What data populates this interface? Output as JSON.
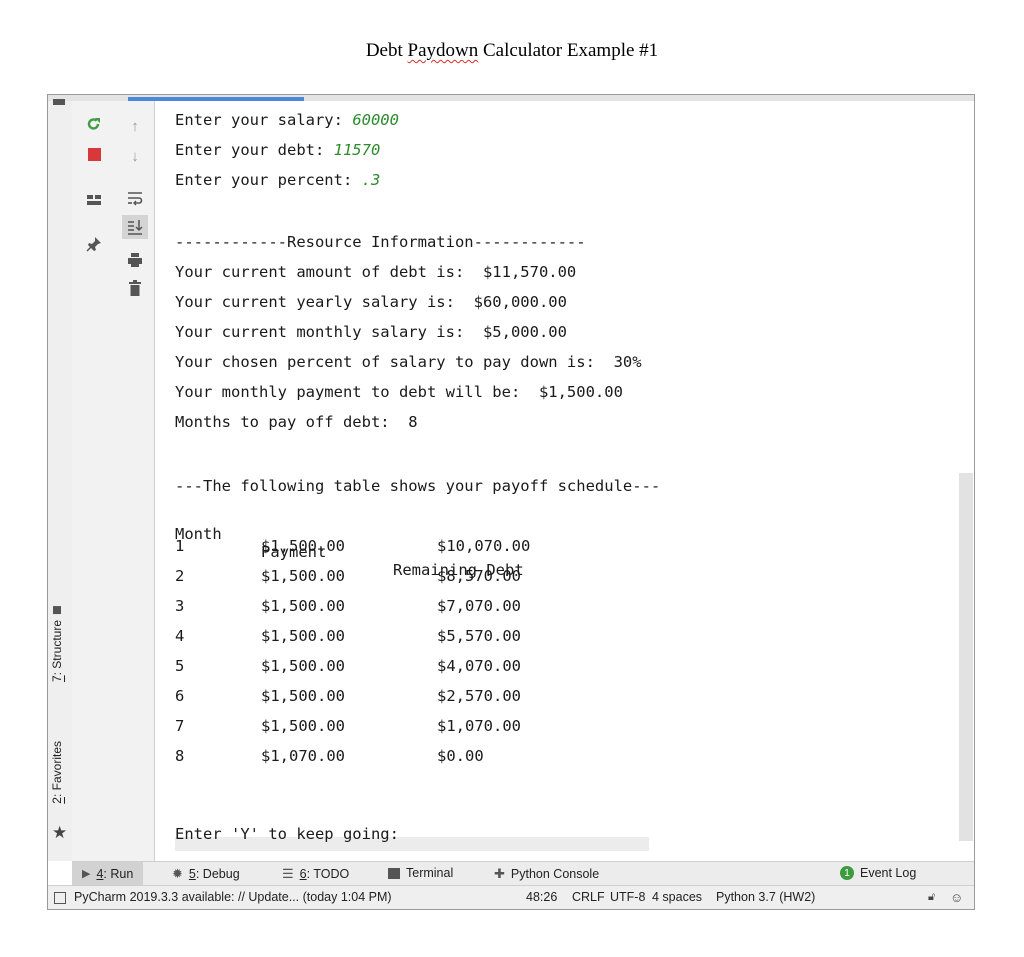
{
  "document": {
    "title_pre": "Debt ",
    "title_spell": "Paydown",
    "title_post": " Calculator Example #1"
  },
  "sidebar": {
    "structure_num": "7",
    "structure_label": ": Structure",
    "favorites_num": "2",
    "favorites_label": ": Favorites"
  },
  "console": {
    "prompts": [
      {
        "label": "Enter your salary: ",
        "value": "60000"
      },
      {
        "label": "Enter your debt: ",
        "value": "11570"
      },
      {
        "label": "Enter your percent: ",
        "value": ".3"
      }
    ],
    "lines": [
      "------------Resource Information------------",
      "Your current amount of debt is:  $11,570.00",
      "Your current yearly salary is:  $60,000.00",
      "Your current monthly salary is:  $5,000.00",
      "Your chosen percent of salary to pay down is:  30%",
      "Your monthly payment to debt will be:  $1,500.00",
      "Months to pay off debt:  8",
      "",
      "---The following table shows your payoff schedule---"
    ],
    "table": {
      "headers": [
        "Month",
        "Payment",
        "Remaining Debt"
      ],
      "rows": [
        [
          "1",
          "$1,500.00",
          "$10,070.00"
        ],
        [
          "2",
          "$1,500.00",
          "$8,570.00"
        ],
        [
          "3",
          "$1,500.00",
          "$7,070.00"
        ],
        [
          "4",
          "$1,500.00",
          "$5,570.00"
        ],
        [
          "5",
          "$1,500.00",
          "$4,070.00"
        ],
        [
          "6",
          "$1,500.00",
          "$2,570.00"
        ],
        [
          "7",
          "$1,500.00",
          "$1,070.00"
        ],
        [
          "8",
          "$1,070.00",
          "$0.00"
        ]
      ]
    },
    "final_prompt": "Enter 'Y' to keep going: "
  },
  "toolwindows": [
    {
      "num": "4",
      "label": ": Run",
      "icon": "run-icon"
    },
    {
      "num": "5",
      "label": ": Debug",
      "icon": "bug-icon"
    },
    {
      "num": "6",
      "label": ": TODO",
      "icon": "list-icon"
    },
    {
      "num": "",
      "label": "Terminal",
      "icon": "terminal-icon"
    },
    {
      "num": "",
      "label": "Python Console",
      "icon": "python-icon"
    }
  ],
  "event_log": {
    "badge": "1",
    "label": "Event Log"
  },
  "status": {
    "message": "PyCharm 2019.3.3 available: // Update... (today 1:04 PM)",
    "position": "48:26",
    "line_sep": "CRLF",
    "encoding": "UTF-8",
    "indent": "4 spaces",
    "interpreter": "Python 3.7 (HW2)"
  },
  "colors": {
    "input_value": "#2e8b2e",
    "rerun": "#3f9e3f",
    "stop": "#d9383a",
    "event_badge": "#3c9b3c",
    "active_tab": "#4a88e0"
  }
}
